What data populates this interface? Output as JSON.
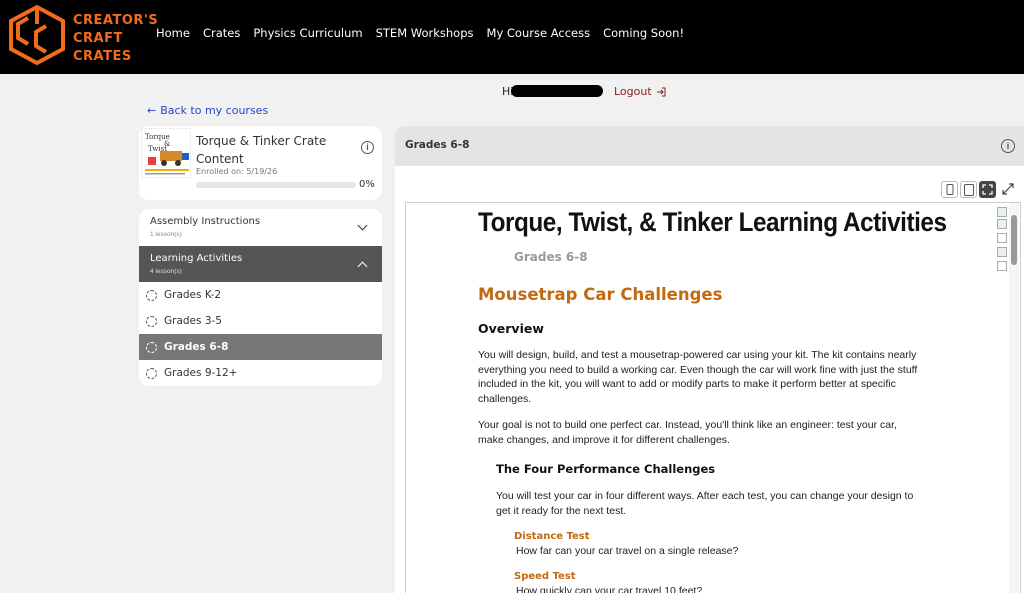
{
  "header": {
    "logo_line1": "CREATOR'S",
    "logo_line2": "CRAFT",
    "logo_line3": "CRATES",
    "nav": [
      "Home",
      "Crates",
      "Physics Curriculum",
      "STEM Workshops",
      "My Course Access",
      "Coming Soon!"
    ]
  },
  "user": {
    "greeting": "Hi",
    "logout": "Logout"
  },
  "back_link": "Back to my courses",
  "course": {
    "title": "Torque & Tinker Crate Content",
    "enrolled": "Enrolled on: 5/19/26",
    "progress_pct": 0,
    "progress_label": "0%"
  },
  "sections": [
    {
      "title": "Assembly Instructions",
      "sub": "1 lesson(s)",
      "expanded": false
    },
    {
      "title": "Learning Activities",
      "sub": "4 lesson(s)",
      "expanded": true
    }
  ],
  "lessons": [
    "Grades K-2",
    "Grades 3-5",
    "Grades 6-8",
    "Grades 9-12+"
  ],
  "active_lesson": "Grades 6-8",
  "pane": {
    "header_title": "Grades 6-8"
  },
  "document": {
    "title": "Torque, Twist, & Tinker Learning Activities",
    "grade": "Grades 6-8",
    "h1": "Mousetrap Car Challenges",
    "overview_heading": "Overview",
    "para1_l1": "You will design, build, and test a mousetrap-powered car using your kit. The kit contains nearly",
    "para1_l2": "everything you need to build a working car.  Even though the car will work fine with just the stuff",
    "para1_l3": "included in the kit, you will want to add or modify parts to make it perform better at specific",
    "para1_l4": "challenges.",
    "para2_l1": "Your goal is not to build one perfect car. Instead, you'll think like an engineer: test your car,",
    "para2_l2": "make changes, and improve it for different challenges.",
    "challenges_heading": "The Four Performance Challenges",
    "para3_l1": "You will test your car in four different ways. After each test, you can change your design to",
    "para3_l2": "get it ready for the next test.",
    "distance_heading": "Distance Test",
    "distance_text": "How far can your car travel on a single release?",
    "speed_heading": "Speed Test",
    "speed_text": "How quickly can your car travel 10 feet?"
  },
  "colors": {
    "accent_orange": "#f26a1b",
    "heading_orange": "#c26a10",
    "link_blue": "#2a45c9",
    "logout_red": "#8b1a1a"
  }
}
